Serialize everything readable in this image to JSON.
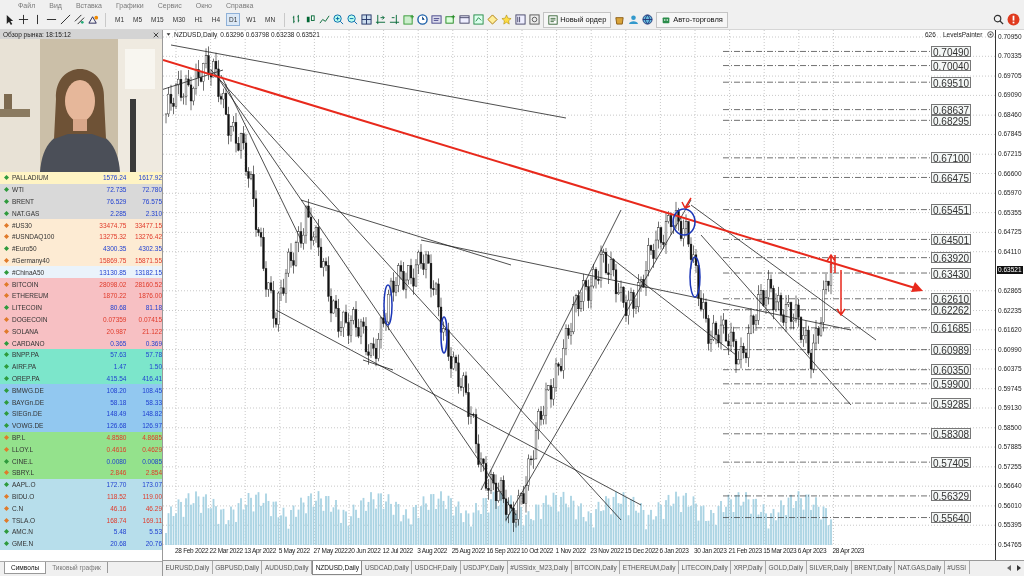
{
  "menu": [
    "Файл",
    "Вид",
    "Вставка",
    "Графики",
    "Сервис",
    "Окно",
    "Справка"
  ],
  "toolbar": {
    "timeframes": [
      {
        "label": "M1",
        "selected": false
      },
      {
        "label": "M5",
        "selected": false
      },
      {
        "label": "M15",
        "selected": false
      },
      {
        "label": "M30",
        "selected": false
      },
      {
        "label": "H1",
        "selected": false
      },
      {
        "label": "H4",
        "selected": false
      },
      {
        "label": "D1",
        "selected": true
      },
      {
        "label": "W1",
        "selected": false
      },
      {
        "label": "MN",
        "selected": false
      }
    ],
    "new_order": "Новый ордер",
    "auto_trading": "Авто-торговля"
  },
  "market_watch": {
    "title": "Обзор рынка: 18:15:12",
    "rows": [
      {
        "symbol": "PALLADIUM",
        "bid": "1576.24",
        "ask": "1617.92",
        "up": true,
        "color": "#fff4c4"
      },
      {
        "symbol": "WTI",
        "bid": "72.735",
        "ask": "72.780",
        "up": true,
        "color": "#d9d9d9"
      },
      {
        "symbol": "BRENT",
        "bid": "76.529",
        "ask": "76.575",
        "up": true,
        "color": "#d9d9d9"
      },
      {
        "symbol": "NAT.GAS",
        "bid": "2.285",
        "ask": "2.310",
        "up": true,
        "color": "#d9d9d9"
      },
      {
        "symbol": "#US30",
        "bid": "33474.75",
        "ask": "33477.15",
        "up": false,
        "color": "#fdebd3"
      },
      {
        "symbol": "#USNDAQ100",
        "bid": "13275.32",
        "ask": "13276.42",
        "up": false,
        "color": "#fdebd3"
      },
      {
        "symbol": "#Euro50",
        "bid": "4300.35",
        "ask": "4302.35",
        "up": true,
        "color": "#fdebd3"
      },
      {
        "symbol": "#Germany40",
        "bid": "15869.75",
        "ask": "15871.55",
        "up": false,
        "color": "#fdebd3"
      },
      {
        "symbol": "#ChinaA50",
        "bid": "13130.85",
        "ask": "13182.15",
        "up": true,
        "color": "#eaf3fb"
      },
      {
        "symbol": "BITCOIN",
        "bid": "28098.02",
        "ask": "28160.52",
        "up": false,
        "color": "#f7c0c3"
      },
      {
        "symbol": "ETHEREUM",
        "bid": "1870.22",
        "ask": "1876.00",
        "up": false,
        "color": "#f7c0c3"
      },
      {
        "symbol": "LITECOIN",
        "bid": "80.68",
        "ask": "81.18",
        "up": true,
        "color": "#f7c0c3"
      },
      {
        "symbol": "DOGECOIN",
        "bid": "0.07359",
        "ask": "0.07415",
        "up": false,
        "color": "#f7c0c3"
      },
      {
        "symbol": "SOLANA",
        "bid": "20.987",
        "ask": "21.122",
        "up": false,
        "color": "#f7c0c3"
      },
      {
        "symbol": "CARDANO",
        "bid": "0.365",
        "ask": "0.369",
        "up": true,
        "color": "#f7c0c3"
      },
      {
        "symbol": "BNPP.PA",
        "bid": "57.63",
        "ask": "57.78",
        "up": true,
        "color": "#7ce6cb"
      },
      {
        "symbol": "AIRF.PA",
        "bid": "1.47",
        "ask": "1.50",
        "up": true,
        "color": "#7ce6cb"
      },
      {
        "symbol": "OREP.PA",
        "bid": "415.54",
        "ask": "416.41",
        "up": true,
        "color": "#7ce6cb"
      },
      {
        "symbol": "BMWG.DE",
        "bid": "108.20",
        "ask": "108.45",
        "up": true,
        "color": "#92c8f0"
      },
      {
        "symbol": "BAYGn.DE",
        "bid": "58.18",
        "ask": "58.33",
        "up": true,
        "color": "#92c8f0"
      },
      {
        "symbol": "SIEGn.DE",
        "bid": "148.49",
        "ask": "148.82",
        "up": true,
        "color": "#92c8f0"
      },
      {
        "symbol": "VOWG.DE",
        "bid": "126.68",
        "ask": "126.97",
        "up": true,
        "color": "#92c8f0"
      },
      {
        "symbol": "BP.L",
        "bid": "4.8580",
        "ask": "4.8685",
        "up": false,
        "color": "#94e28c"
      },
      {
        "symbol": "LLOY.L",
        "bid": "0.4616",
        "ask": "0.4629",
        "up": false,
        "color": "#94e28c"
      },
      {
        "symbol": "CINE.L",
        "bid": "0.0080",
        "ask": "0.0085",
        "up": true,
        "color": "#94e28c"
      },
      {
        "symbol": "SBRY.L",
        "bid": "2.846",
        "ask": "2.854",
        "up": false,
        "color": "#94e28c"
      },
      {
        "symbol": "AAPL.O",
        "bid": "172.70",
        "ask": "173.07",
        "up": true,
        "color": "#b7deeb"
      },
      {
        "symbol": "BIDU.O",
        "bid": "118.52",
        "ask": "119.00",
        "up": false,
        "color": "#b7deeb"
      },
      {
        "symbol": "C.N",
        "bid": "46.16",
        "ask": "46.29",
        "up": false,
        "color": "#b7deeb"
      },
      {
        "symbol": "TSLA.O",
        "bid": "168.74",
        "ask": "169.11",
        "up": false,
        "color": "#b7deeb"
      },
      {
        "symbol": "AMC.N",
        "bid": "5.48",
        "ask": "5.53",
        "up": true,
        "color": "#b7deeb"
      },
      {
        "symbol": "GME.N",
        "bid": "20.68",
        "ask": "20.76",
        "up": true,
        "color": "#b7deeb"
      }
    ],
    "tabs": [
      {
        "label": "Символы",
        "selected": true
      },
      {
        "label": "Тиковый график",
        "selected": false
      }
    ]
  },
  "chart": {
    "symbol": "NZDUSD,Daily",
    "ohlc": "0.63296 0.63798 0.63238 0.63521",
    "bar_count": "626",
    "indicator": "LevelsPainter",
    "price_ticks": [
      "0.70950",
      "0.70335",
      "0.69705",
      "0.69090",
      "0.68460",
      "0.67845",
      "0.67215",
      "0.66600",
      "0.65970",
      "0.65355",
      "0.64725",
      "0.64110",
      "0.62865",
      "0.62235",
      "0.61620",
      "0.60990",
      "0.60375",
      "0.59745",
      "0.59130",
      "0.58500",
      "0.57885",
      "0.57255",
      "0.56640",
      "0.56010",
      "0.55395",
      "0.54765"
    ],
    "current_price": "0.63521",
    "levels": [
      "0.70490",
      "0.70040",
      "0.69510",
      "0.68637",
      "0.68295",
      "0.67100",
      "0.66475",
      "0.65451",
      "0.64501",
      "0.63920",
      "0.63430",
      "0.62610",
      "0.62262",
      "0.61685",
      "0.60989",
      "0.60350",
      "0.59900",
      "0.59285",
      "0.58308",
      "0.57405",
      "0.56329",
      "0.55640"
    ],
    "dates": [
      "28 Feb 2022",
      "22 Mar 2022",
      "13 Apr 2022",
      "5 May 2022",
      "27 May 2022",
      "20 Jun 2022",
      "12 Jul 2022",
      "3 Aug 2022",
      "25 Aug 2022",
      "16 Sep 2022",
      "10 Oct 2022",
      "1 Nov 2022",
      "23 Nov 2022",
      "15 Dec 2022",
      "6 Jan 2023",
      "30 Jan 2023",
      "21 Feb 2023",
      "15 Mar 2023",
      "6 Apr 2023",
      "28 Apr 2023"
    ]
  },
  "chart_tabs": [
    {
      "label": "EURUSD,Daily",
      "selected": false
    },
    {
      "label": "GBPUSD,Daily",
      "selected": false
    },
    {
      "label": "AUDUSD,Daily",
      "selected": false
    },
    {
      "label": "NZDUSD,Daily",
      "selected": true
    },
    {
      "label": "USDCAD,Daily",
      "selected": false
    },
    {
      "label": "USDCHF,Daily",
      "selected": false
    },
    {
      "label": "USDJPY,Daily",
      "selected": false
    },
    {
      "label": "#USSidx_M23,Daily",
      "selected": false
    },
    {
      "label": "BITCOIN,Daily",
      "selected": false
    },
    {
      "label": "ETHEREUM,Daily",
      "selected": false
    },
    {
      "label": "LITECOIN,Daily",
      "selected": false
    },
    {
      "label": "XRP,Daily",
      "selected": false
    },
    {
      "label": "GOLD,Daily",
      "selected": false
    },
    {
      "label": "SILVER,Daily",
      "selected": false
    },
    {
      "label": "BRENT,Daily",
      "selected": false
    },
    {
      "label": "NAT.GAS,Daily",
      "selected": false
    },
    {
      "label": "#USSI",
      "selected": false
    }
  ]
}
